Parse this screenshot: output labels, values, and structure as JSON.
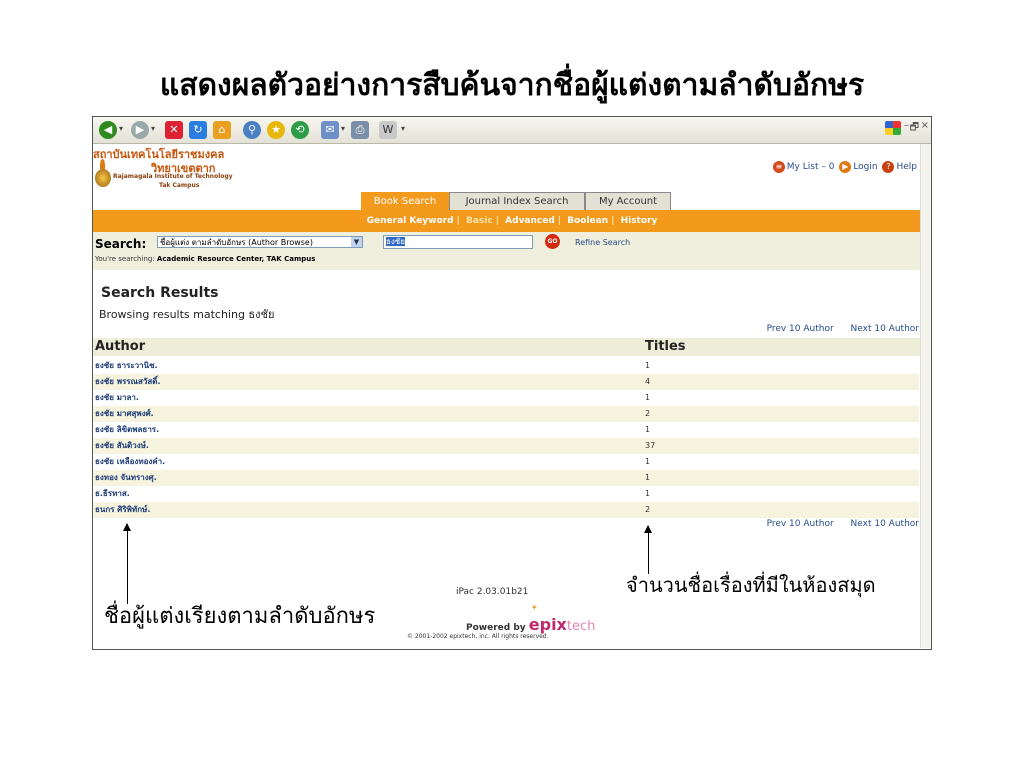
{
  "slide": {
    "title": "แสดงผลตัวอย่างการสืบค้นจากชื่อผู้แต่งตามลำดับอักษร",
    "annotation_author": "ชื่อผู้แต่งเรียงตามลำดับอักษร",
    "annotation_titles": "จำนวนชื่อเรื่องที่มีในห้องสมุด"
  },
  "browser": {
    "win_controls": [
      "–",
      "🗗",
      "×"
    ]
  },
  "header": {
    "logo_line1": "สถาบันเทคโนโลยีราชมงคล",
    "logo_line2": "วิทยาเขตตาก",
    "logo_line3": "Rajamagala Institute of Technology",
    "logo_line4": "Tak Campus",
    "my_list": "My List – 0",
    "login": "Login",
    "help": "Help"
  },
  "tabs": [
    {
      "label": "Book Search"
    },
    {
      "label": "Journal Index Search"
    },
    {
      "label": "My Account"
    }
  ],
  "subnav": [
    "General Keyword",
    "Basic",
    "Advanced",
    "Boolean",
    "History"
  ],
  "search": {
    "label": "Search:",
    "select_value": "ชื่อผู้แต่ง ตามลำดับอักษร (Author Browse)",
    "input_value": "ธงชัย",
    "go_label": "GO",
    "refine": "Refine Search",
    "scope_prefix": "You're searching:",
    "scope_name": "Academic Resource Center, TAK Campus"
  },
  "results": {
    "heading": "Search Results",
    "subheading": "Browsing results matching ธงชัย",
    "prev": "Prev 10 Author",
    "next": "Next 10 Author",
    "col_author": "Author",
    "col_titles": "Titles",
    "rows": [
      {
        "author": "ธงชัย ธาระวานิช.",
        "titles": "1"
      },
      {
        "author": "ธงชัย พรรณสวัสดิ์.",
        "titles": "4"
      },
      {
        "author": "ธงชัย มาลา.",
        "titles": "1"
      },
      {
        "author": "ธงชัย มาศสุพงศ์.",
        "titles": "2"
      },
      {
        "author": "ธงชัย ลิขิตพลธาร.",
        "titles": "1"
      },
      {
        "author": "ธงชัย สันติวงษ์.",
        "titles": "37"
      },
      {
        "author": "ธงชัย เหลืองทองคำ.",
        "titles": "1"
      },
      {
        "author": "ธงทอง จันทรางศุ.",
        "titles": "1"
      },
      {
        "author": "ธ.ธีรทาส.",
        "titles": "1"
      },
      {
        "author": "ธนกร ศิริพิทักษ์.",
        "titles": "2"
      }
    ]
  },
  "footer": {
    "version": "iPac 2.03.01b21",
    "powered_by": "Powered by",
    "brand": "epix",
    "brand_tail": "tech",
    "copyright": "© 2001-2002 epixtech, inc. All rights reserved."
  }
}
